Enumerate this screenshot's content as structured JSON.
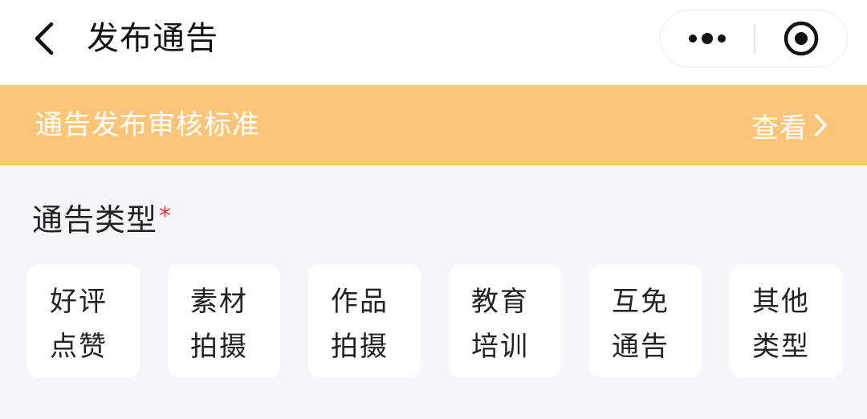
{
  "header": {
    "title": "发布通告",
    "back_icon": "chevron-left-icon",
    "more_icon": "more-dots-icon",
    "close_icon": "target-icon"
  },
  "banner": {
    "text": "通告发布审核标准",
    "link_label": "查看",
    "link_icon": "chevron-right-icon",
    "background": "#fcc67a"
  },
  "section": {
    "title": "通告类型",
    "required_mark": "*",
    "types": [
      {
        "line1": "好评",
        "line2": "点赞"
      },
      {
        "line1": "素材",
        "line2": "拍摄"
      },
      {
        "line1": "作品",
        "line2": "拍摄"
      },
      {
        "line1": "教育",
        "line2": "培训"
      },
      {
        "line1": "互免",
        "line2": "通告"
      },
      {
        "line1": "其他",
        "line2": "类型"
      }
    ]
  },
  "colors": {
    "accent": "#fcc67a",
    "required": "#e23b3b",
    "page_bg": "#f6f6fa"
  }
}
